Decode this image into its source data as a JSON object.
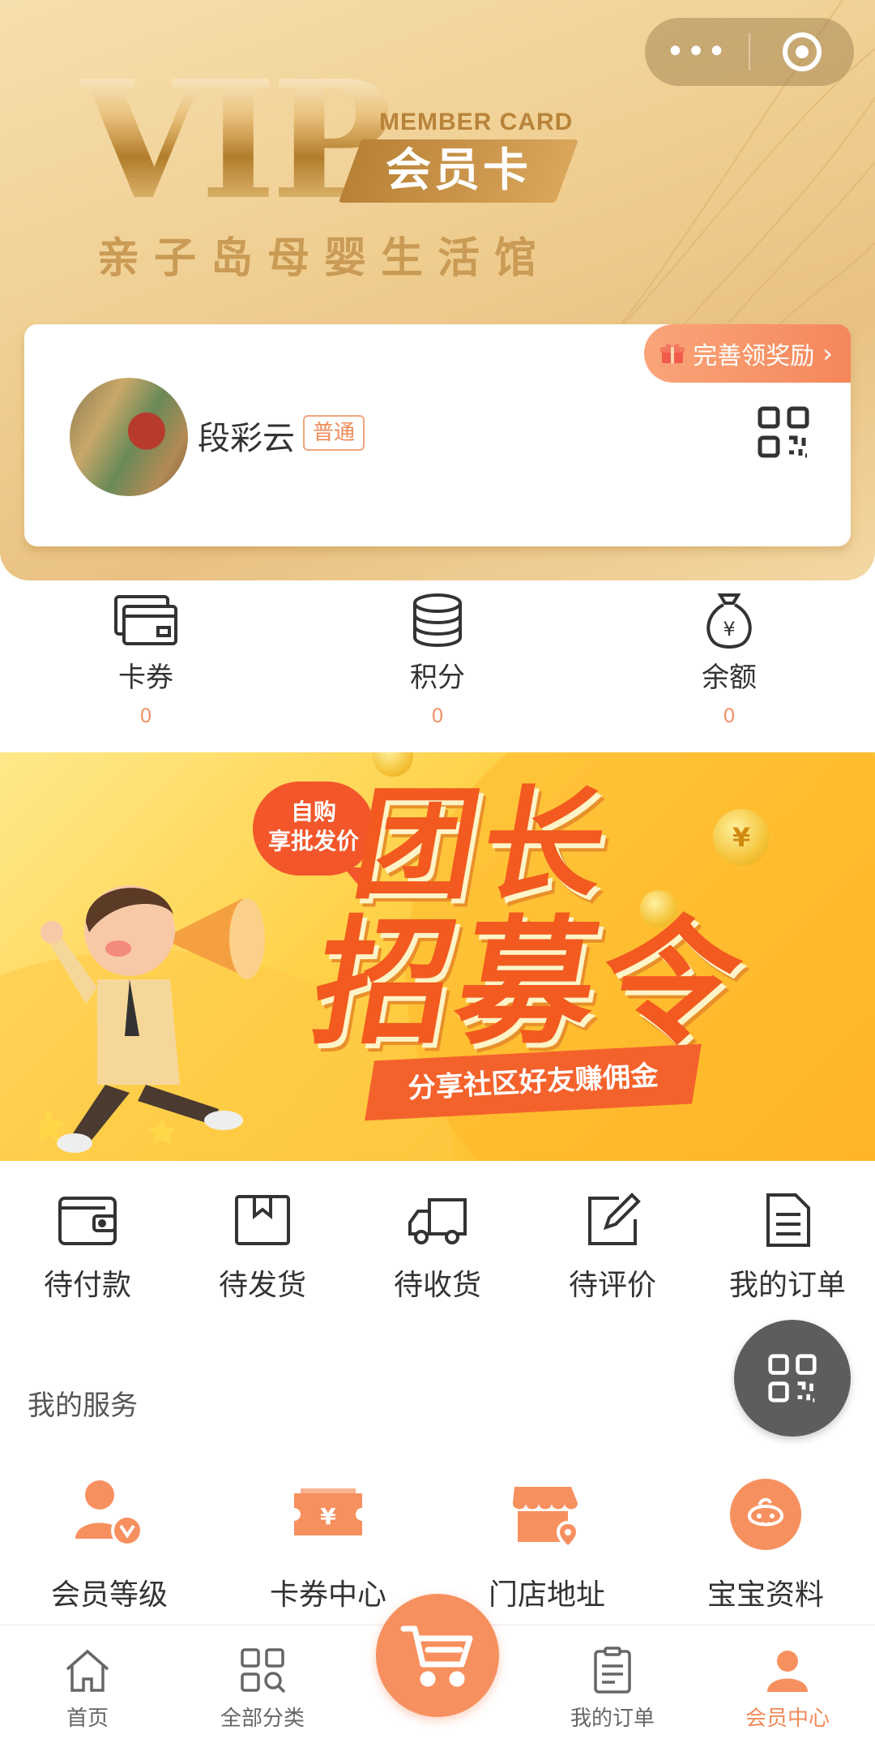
{
  "header": {
    "vip_text": "VIP",
    "member_card_en": "MEMBER CARD",
    "member_card_zh": "会员卡",
    "store_name": "亲子岛母婴生活馆",
    "capsule_more": "•••"
  },
  "user": {
    "reward_tag": "完善领奖励",
    "name": "段彩云",
    "level": "普通"
  },
  "assets": [
    {
      "label": "卡券",
      "value": "0",
      "icon": "card-icon"
    },
    {
      "label": "积分",
      "value": "0",
      "icon": "coins-icon"
    },
    {
      "label": "余额",
      "value": "0",
      "icon": "money-bag-icon"
    }
  ],
  "banner": {
    "bubble_line1": "自购",
    "bubble_line2": "享批发价",
    "title_line1": "团长",
    "title_line2": "招募令",
    "ribbon": "分享社区好友赚佣金",
    "coin_symbol": "¥"
  },
  "orders": [
    {
      "label": "待付款",
      "icon": "wallet-icon"
    },
    {
      "label": "待发货",
      "icon": "box-icon"
    },
    {
      "label": "待收货",
      "icon": "truck-icon"
    },
    {
      "label": "待评价",
      "icon": "edit-icon"
    },
    {
      "label": "我的订单",
      "icon": "document-icon"
    }
  ],
  "services": {
    "title": "我的服务",
    "items": [
      {
        "label": "会员等级",
        "icon": "member-level-icon"
      },
      {
        "label": "卡券中心",
        "icon": "coupon-icon"
      },
      {
        "label": "门店地址",
        "icon": "store-location-icon"
      },
      {
        "label": "宝宝资料",
        "icon": "baby-icon"
      }
    ]
  },
  "tabbar": {
    "items": [
      {
        "label": "首页",
        "icon": "home-icon"
      },
      {
        "label": "全部分类",
        "icon": "category-icon"
      },
      {
        "label": "",
        "icon": "cart-icon"
      },
      {
        "label": "我的订单",
        "icon": "order-clipboard-icon"
      },
      {
        "label": "会员中心",
        "icon": "user-icon"
      }
    ],
    "active_index": 4
  },
  "colors": {
    "accent": "#f08a58",
    "gold": "#c99b55",
    "banner_red": "#f25a1f"
  }
}
